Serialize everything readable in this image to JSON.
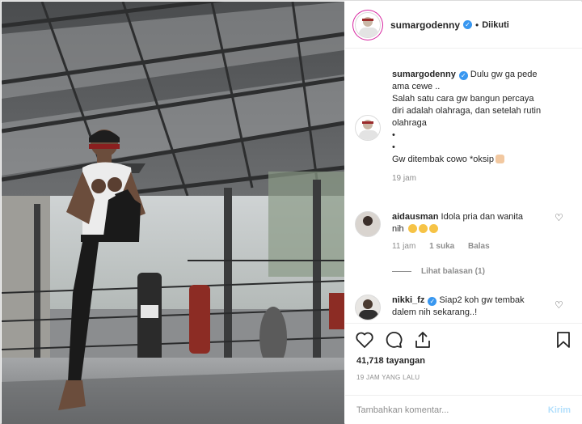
{
  "post": {
    "username": "sumargodenny",
    "follow_state": "Diikuti",
    "separator": "•",
    "caption_lines": [
      "Dulu gw ga pede",
      "ama cewe ..",
      "Salah satu cara gw bangun percaya",
      "diri adalah olahraga, dan setelah rutin",
      "olahraga",
      "•",
      "•",
      "Gw ditembak cowo *oksip"
    ],
    "caption_time": "19 jam"
  },
  "comments": [
    {
      "username": "aidausman",
      "text_line1": "Idola pria dan wanita",
      "text_line2": "nih",
      "time": "11 jam",
      "likes": "1 suka",
      "reply_label": "Balas",
      "view_replies": "Lihat balasan (1)"
    },
    {
      "username": "nikki_fz",
      "text_line1": "Siap2 koh gw tembak",
      "text_line2": "dalem nih sekarang..!"
    }
  ],
  "stats": {
    "views": "41,718 tayangan",
    "posted": "19 JAM YANG LALU"
  },
  "composer": {
    "placeholder": "Tambahkan komentar...",
    "post_label": "Kirim"
  },
  "icons": {
    "like": "heart-icon",
    "comment": "comment-icon",
    "share": "share-icon",
    "save": "bookmark-icon"
  },
  "colors": {
    "verified": "#3897f0",
    "muted": "#8e8e8e",
    "post_disabled": "#b2dffc"
  }
}
